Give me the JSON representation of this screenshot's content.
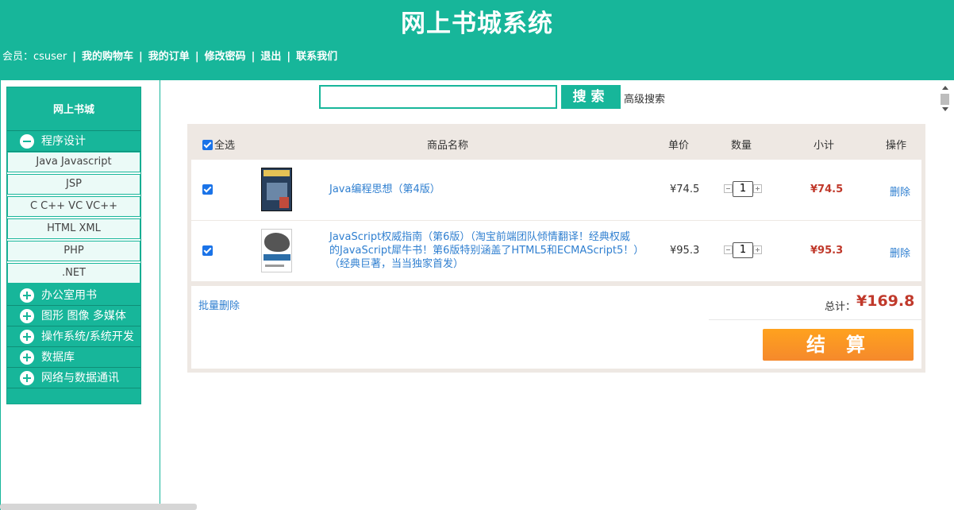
{
  "header": {
    "title": "网上书城系统",
    "member_label": "会员：csuser",
    "separator": "|",
    "links": [
      "我的购物车",
      "我的订单",
      "修改密码",
      "退出",
      "联系我们"
    ]
  },
  "sidebar": {
    "title": "网上书城",
    "expanded_category": "程序设计",
    "sub_items": [
      "Java Javascript",
      "JSP",
      "C C++ VC VC++",
      "HTML XML",
      "PHP",
      ".NET"
    ],
    "categories": [
      "办公室用书",
      "图形 图像 多媒体",
      "操作系统/系统开发",
      "数据库",
      "网络与数据通讯"
    ]
  },
  "search": {
    "value": "",
    "button_label": "搜索",
    "advanced_label": "高级搜索"
  },
  "cart": {
    "headers": {
      "select_all": "全选",
      "name": "商品名称",
      "price": "单价",
      "quantity": "数量",
      "subtotal": "小计",
      "action": "操作"
    },
    "items": [
      {
        "checked": true,
        "name_lines": [
          "Java编程思想（第4版）"
        ],
        "price": "¥74.5",
        "quantity": "1",
        "subtotal": "¥74.5",
        "delete_label": "删除"
      },
      {
        "checked": true,
        "name_lines": [
          "JavaScript权威指南（第6版）（淘宝前端团队倾情翻译！经典权威",
          "的JavaScript犀牛书！第6版特别涵盖了HTML5和ECMAScript5！）",
          "（经典巨著，当当独家首发）"
        ],
        "price": "¥95.3",
        "quantity": "1",
        "subtotal": "¥95.3",
        "delete_label": "删除"
      }
    ],
    "batch_delete": "批量删除",
    "total_label": "总计：",
    "total_value": "¥169.8",
    "checkout_label": "结算"
  },
  "colors": {
    "brand": "#17b69a",
    "price_red": "#c0392b",
    "link_blue": "#2f7fd0",
    "checkout_orange": "#f7962a"
  }
}
